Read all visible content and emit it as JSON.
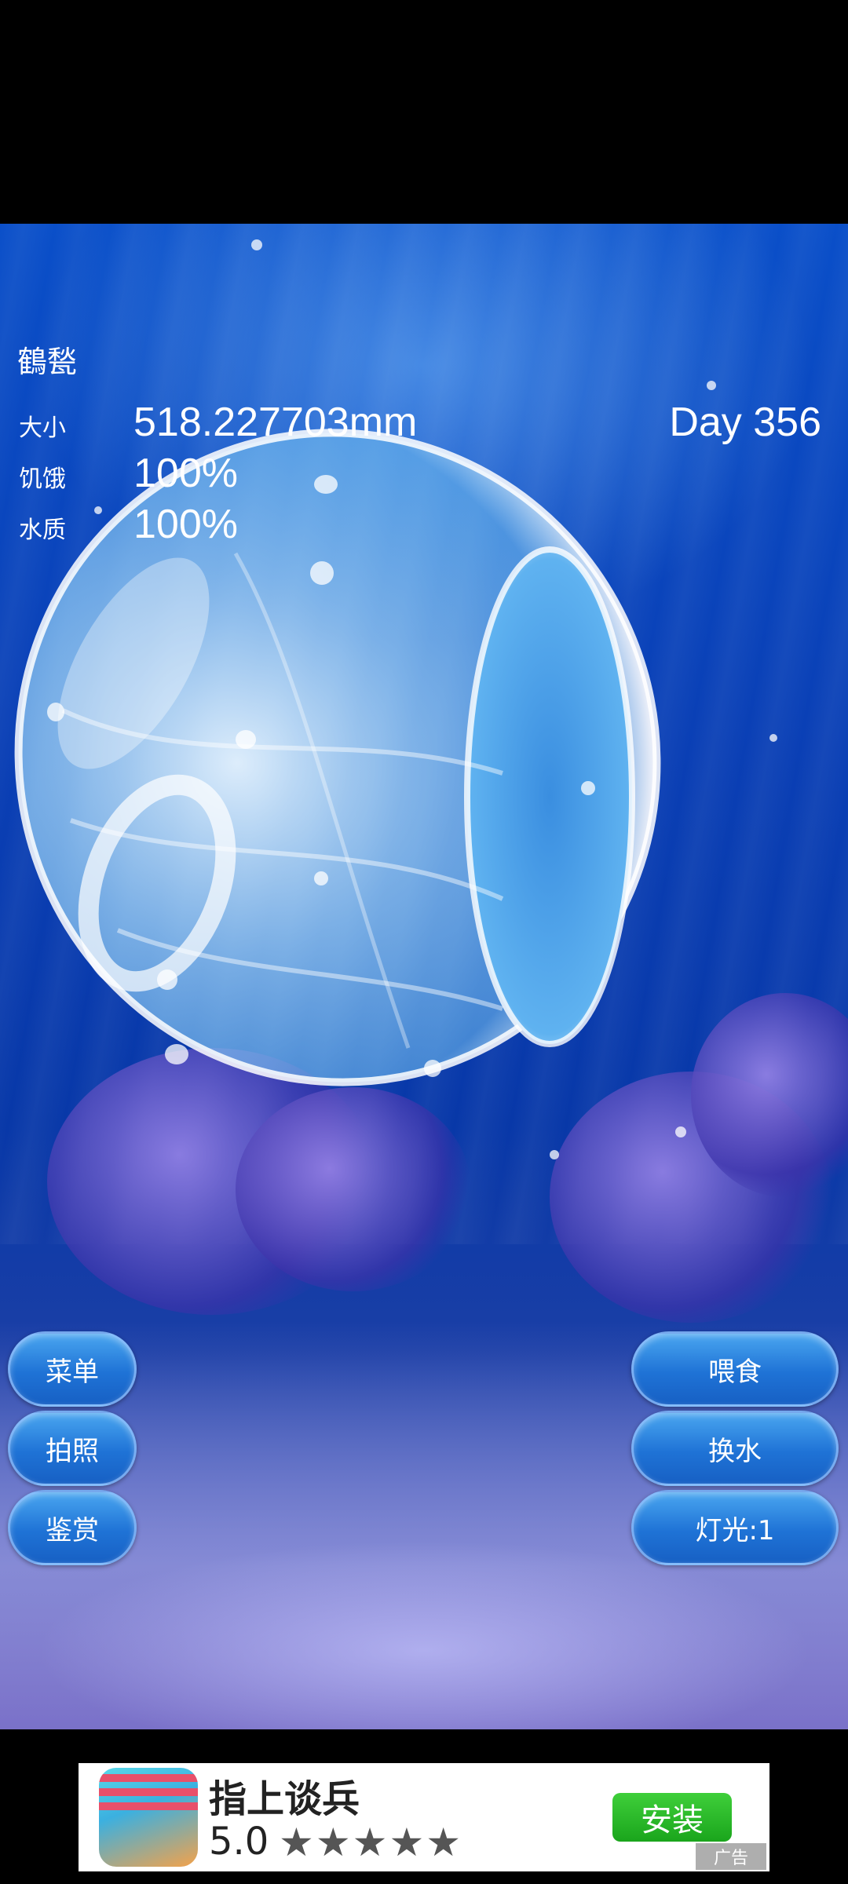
{
  "jellyfish_name": "鶴甃",
  "stats": [
    {
      "label": "大小",
      "value": "518.227703mm"
    },
    {
      "label": "饥饿",
      "value": "100%"
    },
    {
      "label": "水质",
      "value": "100%"
    }
  ],
  "day": "Day 356",
  "buttons_left": [
    "菜单",
    "拍照",
    "鉴赏"
  ],
  "buttons_right": [
    "喂食",
    "换水",
    "灯光:1"
  ],
  "ad": {
    "title": "指上谈兵",
    "rating": "5.0",
    "stars": "★★★★★",
    "install_label": "安装",
    "tag": "广告"
  }
}
